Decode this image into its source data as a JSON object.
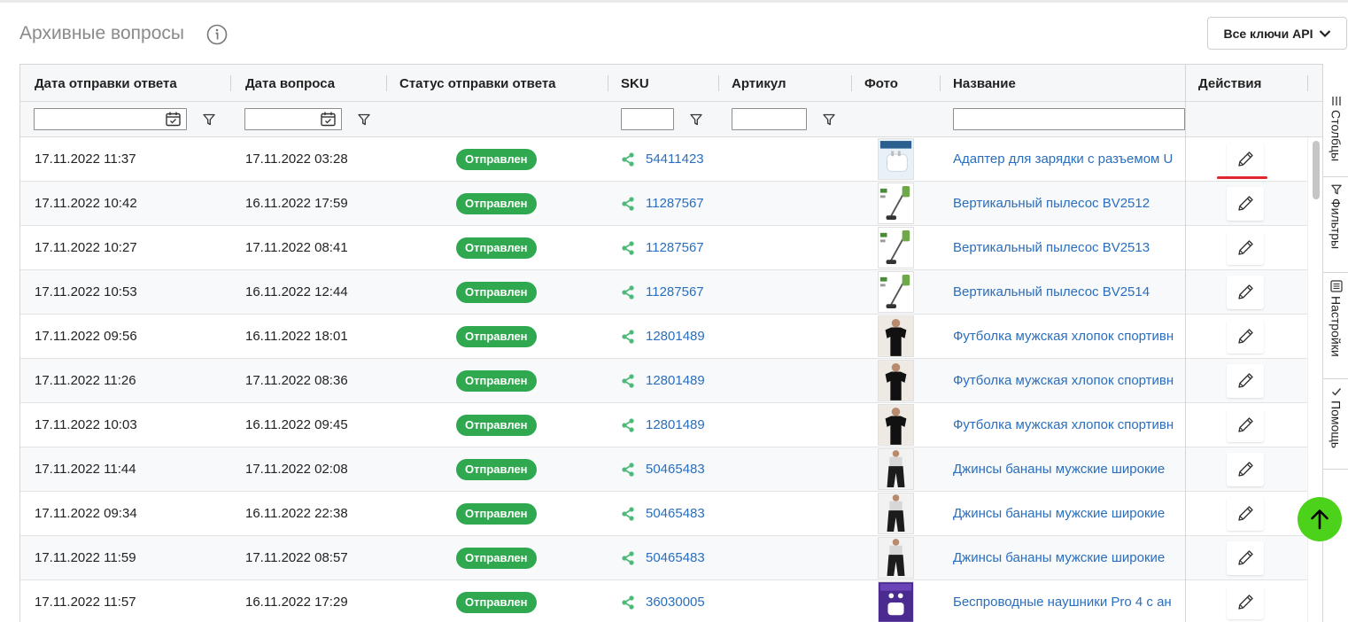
{
  "page": {
    "title": "Архивные вопросы",
    "api_button_label": "Все ключи API"
  },
  "columns": {
    "answer_date": "Дата отправки ответа",
    "question_date": "Дата вопроса",
    "status": "Статус отправки ответа",
    "sku": "SKU",
    "article": "Артикул",
    "photo": "Фото",
    "name": "Название",
    "actions": "Действия"
  },
  "side_panel": {
    "columns": "Столбцы",
    "filters": "Фильтры",
    "settings": "Настройки",
    "help": "Помощь"
  },
  "rows": [
    {
      "answer_date": "17.11.2022 11:37",
      "question_date": "17.11.2022 03:28",
      "status": "Отправлен",
      "sku": "54411423",
      "article": "",
      "name": "Адаптер для зарядки с разъемом U",
      "photo_icon": "charger-product-icon"
    },
    {
      "answer_date": "17.11.2022 10:42",
      "question_date": "16.11.2022 17:59",
      "status": "Отправлен",
      "sku": "11287567",
      "article": "",
      "name": "Вертикальный пылесос BV2512",
      "photo_icon": "vacuum-product-icon"
    },
    {
      "answer_date": "17.11.2022 10:27",
      "question_date": "17.11.2022 08:41",
      "status": "Отправлен",
      "sku": "11287567",
      "article": "",
      "name": "Вертикальный пылесос BV2513",
      "photo_icon": "vacuum-product-icon"
    },
    {
      "answer_date": "17.11.2022 10:53",
      "question_date": "16.11.2022 12:44",
      "status": "Отправлен",
      "sku": "11287567",
      "article": "",
      "name": "Вертикальный пылесос BV2514",
      "photo_icon": "vacuum-product-icon"
    },
    {
      "answer_date": "17.11.2022 09:56",
      "question_date": "16.11.2022 18:01",
      "status": "Отправлен",
      "sku": "12801489",
      "article": "",
      "name": "Футболка мужская хлопок спортивн",
      "photo_icon": "tshirt-product-icon"
    },
    {
      "answer_date": "17.11.2022 11:26",
      "question_date": "17.11.2022 08:36",
      "status": "Отправлен",
      "sku": "12801489",
      "article": "",
      "name": "Футболка мужская хлопок спортивн",
      "photo_icon": "tshirt-product-icon"
    },
    {
      "answer_date": "17.11.2022 10:03",
      "question_date": "16.11.2022 09:45",
      "status": "Отправлен",
      "sku": "12801489",
      "article": "",
      "name": "Футболка мужская хлопок спортивн",
      "photo_icon": "tshirt-product-icon"
    },
    {
      "answer_date": "17.11.2022 11:44",
      "question_date": "17.11.2022 02:08",
      "status": "Отправлен",
      "sku": "50465483",
      "article": "",
      "name": "Джинсы бананы мужские широкие",
      "photo_icon": "jeans-product-icon"
    },
    {
      "answer_date": "17.11.2022 09:34",
      "question_date": "16.11.2022 22:38",
      "status": "Отправлен",
      "sku": "50465483",
      "article": "",
      "name": "Джинсы бананы мужские широкие",
      "photo_icon": "jeans-product-icon"
    },
    {
      "answer_date": "17.11.2022 11:59",
      "question_date": "17.11.2022 08:57",
      "status": "Отправлен",
      "sku": "50465483",
      "article": "",
      "name": "Джинсы бананы мужские широкие",
      "photo_icon": "jeans-product-icon"
    },
    {
      "answer_date": "17.11.2022 11:57",
      "question_date": "16.11.2022 17:29",
      "status": "Отправлен",
      "sku": "36030005",
      "article": "",
      "name": "Беспроводные наушники Pro 4 с ан",
      "photo_icon": "earphones-product-icon"
    }
  ],
  "colors": {
    "status_green": "#2fa84f",
    "link_blue": "#2a6ebd",
    "scroll_up_green": "#4cd21a",
    "highlight_red": "#e0262c"
  }
}
